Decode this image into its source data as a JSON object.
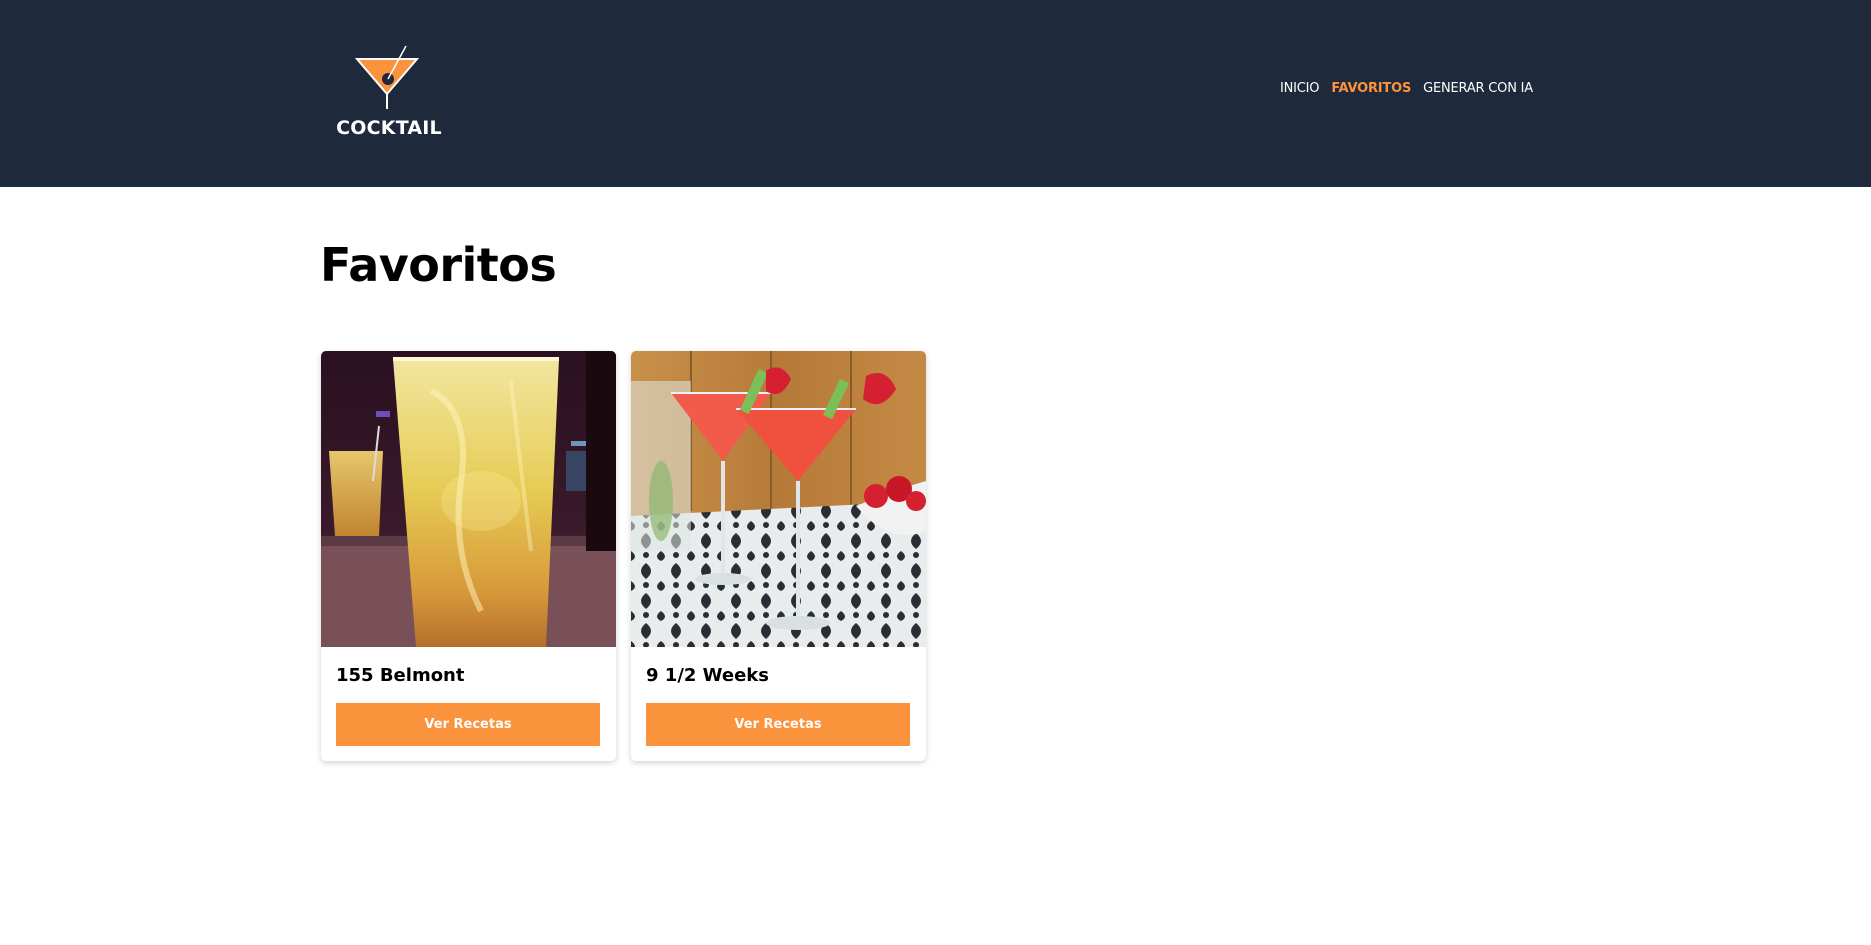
{
  "brand": {
    "name": "COCKTAIL",
    "accent": "#fb923c",
    "header_bg": "#1e293b"
  },
  "nav": {
    "items": [
      {
        "label": "INICIO",
        "active": false
      },
      {
        "label": "FAVORITOS",
        "active": true
      },
      {
        "label": "GENERAR CON IA",
        "active": false
      }
    ]
  },
  "main": {
    "title": "Favoritos",
    "cards": [
      {
        "name": "155 Belmont",
        "button_label": "Ver Recetas"
      },
      {
        "name": "9 1/2 Weeks",
        "button_label": "Ver Recetas"
      }
    ]
  }
}
